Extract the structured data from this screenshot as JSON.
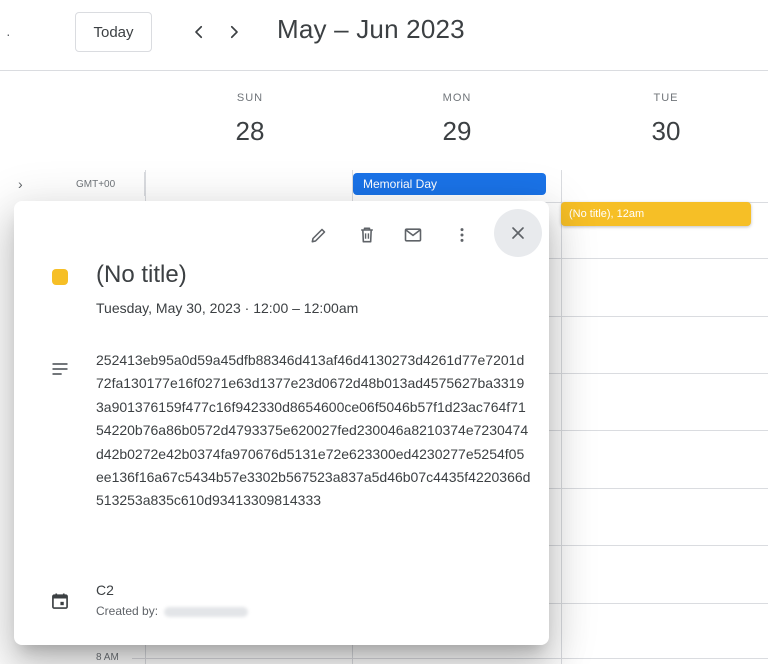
{
  "header": {
    "today_label": "Today",
    "prev_symbol": "‹",
    "next_symbol": "›",
    "range_title": "May – Jun 2023",
    "left_edge_mark": "·"
  },
  "days": [
    {
      "name": "SUN",
      "number": "28"
    },
    {
      "name": "MON",
      "number": "29"
    },
    {
      "name": "TUE",
      "number": "30"
    }
  ],
  "allday": {
    "expand_symbol": "›",
    "timezone": "GMT+00",
    "memorial_event": "Memorial Day",
    "event_chip": "(No title), 12am"
  },
  "grid": {
    "time_label_8am": "8 AM"
  },
  "popup": {
    "title": "(No title)",
    "date_time": "Tuesday, May 30, 2023  ·  12:00 – 12:00am",
    "description": "252413eb95a0d59a45dfb88346d413af46d4130273d4261d77e7201d72fa130177e16f0271e63d1377e23d0672d48b013ad4575627ba33193a901376159f477c16f942330d8654600ce06f5046b57f1d23ac764f7154220b76a86b0572d4793375e620027fed230046a8210374e7230474d42b0272e42b0374fa970676d5131e72e623300ed4230277e5254f05ee136f16a67c5434b57e3302b567523a837a5d46b07c4435f4220366d513253a835c610d93413309814333",
    "calendar_name": "C2",
    "created_by_label": "Created by:",
    "event_color": "#f6bf26"
  },
  "colors": {
    "accent_blue": "#1a73e8",
    "event_yellow": "#f6bf26"
  }
}
